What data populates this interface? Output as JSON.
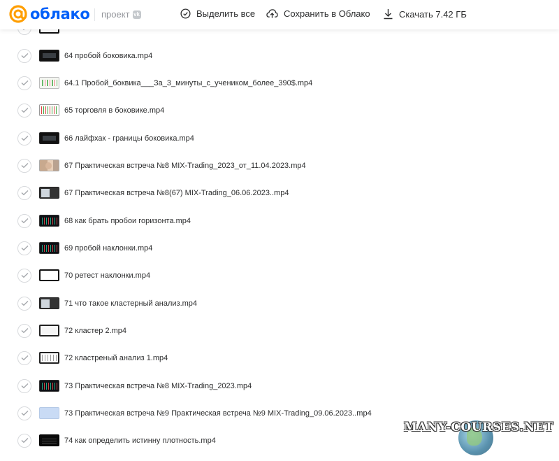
{
  "header": {
    "logo_text": "облако",
    "project_label": "проект",
    "vk_badge": "vk",
    "select_all": "Выделить все",
    "save_to_cloud": "Сохранить в Облако",
    "download": "Скачать 7.42 ГБ"
  },
  "files": [
    {
      "name": "",
      "thumb": "t-frame"
    },
    {
      "name": "64 пробой боковика.mp4",
      "thumb": "t-dark"
    },
    {
      "name": "64.1 Пробой_боквика___За_3_минуты_с_учеником_более_390$.mp4",
      "thumb": "t-green"
    },
    {
      "name": "65 торговля в боковике.mp4",
      "thumb": "t-light"
    },
    {
      "name": "66 лайфхак - границы боковика.mp4",
      "thumb": "t-dark"
    },
    {
      "name": "67 Практическая встреча №8 MIX-Trading_2023_от_11.04.2023.mp4",
      "thumb": "t-face"
    },
    {
      "name": "67 Практическая встреча №8(67) MIX-Trading_06.06.2023..mp4",
      "thumb": "t-mix"
    },
    {
      "name": "68 как брать пробои горизонта.mp4",
      "thumb": "t-chart"
    },
    {
      "name": "69 пробой наклонки.mp4",
      "thumb": "t-chart"
    },
    {
      "name": "70 ретест наклонки.mp4",
      "thumb": "t-frame"
    },
    {
      "name": "71 что такое кластерный анализ.mp4",
      "thumb": "t-mix"
    },
    {
      "name": "72 кластер 2.mp4",
      "thumb": "t-whitebox"
    },
    {
      "name": "72 кластреный анализ 1.mp4",
      "thumb": "t-chartlight"
    },
    {
      "name": "73 Практическая встреча №8 MIX-Trading_2023.mp4",
      "thumb": "t-chart"
    },
    {
      "name": "73 Практическая встреча №9 Практическая встреча №9 MIX-Trading_09.06.2023..mp4",
      "thumb": "t-blue"
    },
    {
      "name": "74 как определить истинну плотность.mp4",
      "thumb": "t-black"
    }
  ],
  "watermark": "MANY-COURSES.NET"
}
